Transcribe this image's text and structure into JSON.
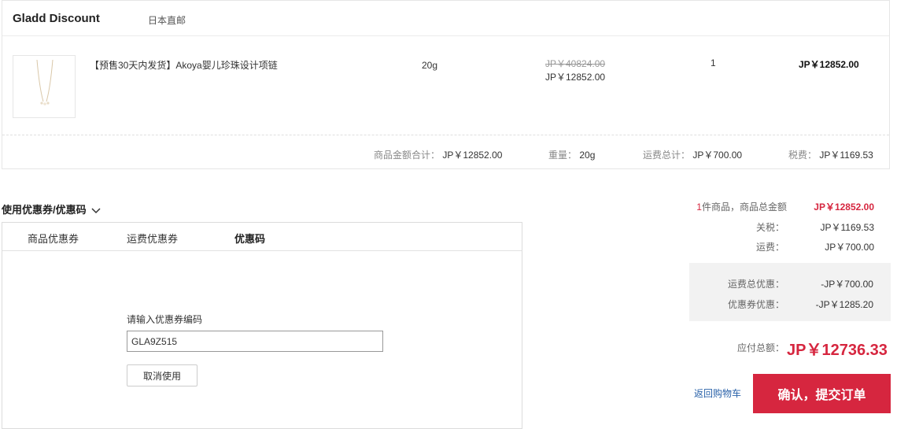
{
  "store": {
    "name": "Gladd Discount",
    "tag": "日本直邮"
  },
  "product": {
    "name": "【预售30天内发货】Akoya婴儿珍珠设计项链",
    "weight": "20g",
    "original_price": "JP￥40824.00",
    "price": "JP￥12852.00",
    "quantity": "1",
    "subtotal": "JP￥12852.00"
  },
  "order_summary": {
    "items_total_label": "商品金额合计：",
    "items_total": "JP￥12852.00",
    "weight_label": "重量：",
    "weight": "20g",
    "shipping_label": "运费总计：",
    "shipping": "JP￥700.00",
    "tax_label": "税费：",
    "tax": "JP￥1169.53"
  },
  "coupon": {
    "title": "使用优惠券/优惠码",
    "tabs": [
      {
        "label": "商品优惠券"
      },
      {
        "label": "运费优惠券"
      },
      {
        "label": "优惠码"
      }
    ],
    "code_label": "请输入优惠券编码",
    "code_value": "GLA9Z515",
    "cancel_label": "取消使用"
  },
  "totals": {
    "goods_count": "1",
    "goods_label": "件商品，商品总金额",
    "goods_amount": "JP￥12852.00",
    "duty_label": "关税：",
    "duty": "JP￥1169.53",
    "shipping_label": "运费：",
    "shipping": "JP￥700.00",
    "shipping_discount_label": "运费总优惠：",
    "shipping_discount": "-JP￥700.00",
    "coupon_discount_label": "优惠券优惠：",
    "coupon_discount": "-JP￥1285.20",
    "payable_label": "应付总额：",
    "payable": "JP￥12736.33"
  },
  "actions": {
    "back_label": "返回购物车",
    "submit_label": "确认，提交订单"
  },
  "colors": {
    "accent": "#d6263f",
    "link": "#2a62a9"
  }
}
